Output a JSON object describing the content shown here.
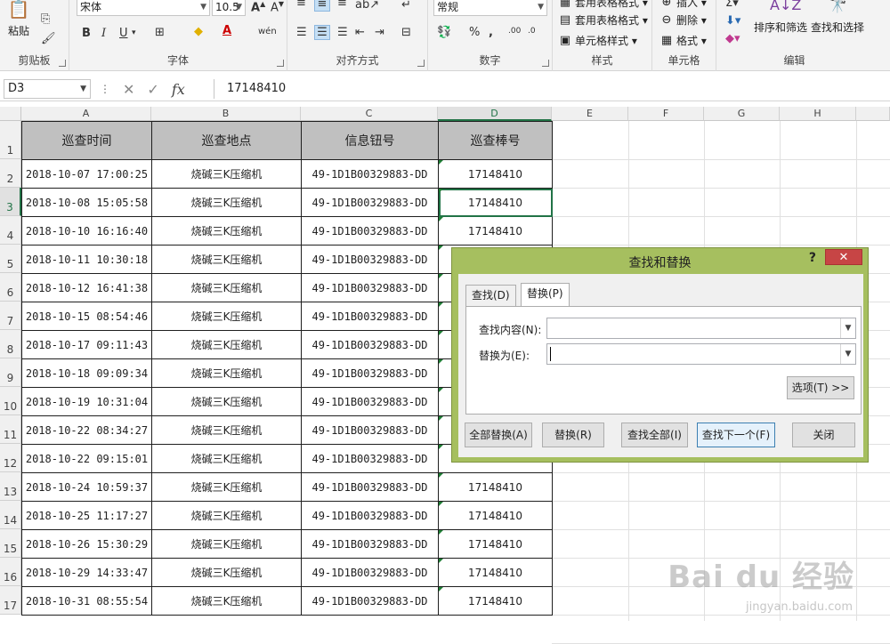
{
  "ribbon": {
    "clipboard": {
      "paste_label": "粘贴",
      "group_title": "剪贴板"
    },
    "font": {
      "font_name": "宋体",
      "font_size": "10.5",
      "bold": "B",
      "italic": "I",
      "underline": "U",
      "wen": "wén",
      "group_title": "字体"
    },
    "alignment": {
      "group_title": "对齐方式"
    },
    "number": {
      "format": "常规",
      "percent": "%",
      "comma": ",",
      "group_title": "数字"
    },
    "styles": {
      "conditional_label": "套用表格格式 ▾",
      "table_label": "套用表格格式 ▾",
      "cell_label": "单元格样式 ▾",
      "group_title": "样式"
    },
    "cells": {
      "insert_label": "插入 ▾",
      "delete_label": "删除 ▾",
      "format_label": "格式 ▾",
      "group_title": "单元格"
    },
    "editing": {
      "sort_label": "排序和筛选",
      "find_label": "查找和选择",
      "group_title": "编辑"
    }
  },
  "formula_bar": {
    "name_box": "D3",
    "formula": "17148410",
    "fx": "fx"
  },
  "sheet": {
    "column_letters": [
      "A",
      "B",
      "C",
      "D",
      "E",
      "F",
      "G",
      "H"
    ],
    "row_numbers": [
      "1",
      "2",
      "3",
      "4",
      "5",
      "6",
      "7",
      "8",
      "9",
      "10",
      "11",
      "12",
      "13",
      "14",
      "15",
      "16",
      "17"
    ],
    "headers": [
      "巡查时间",
      "巡查地点",
      "信息钮号",
      "巡查棒号"
    ],
    "rows": [
      [
        "2018-10-07 17:00:25",
        "烧碱三K压缩机",
        "49-1D1B00329883-DD",
        "17148410"
      ],
      [
        "2018-10-08 15:05:58",
        "烧碱三K压缩机",
        "49-1D1B00329883-DD",
        "17148410"
      ],
      [
        "2018-10-10 16:16:40",
        "烧碱三K压缩机",
        "49-1D1B00329883-DD",
        "17148410"
      ],
      [
        "2018-10-11 10:30:18",
        "烧碱三K压缩机",
        "49-1D1B00329883-DD",
        ""
      ],
      [
        "2018-10-12 16:41:38",
        "烧碱三K压缩机",
        "49-1D1B00329883-DD",
        ""
      ],
      [
        "2018-10-15 08:54:46",
        "烧碱三K压缩机",
        "49-1D1B00329883-DD",
        ""
      ],
      [
        "2018-10-17 09:11:43",
        "烧碱三K压缩机",
        "49-1D1B00329883-DD",
        ""
      ],
      [
        "2018-10-18 09:09:34",
        "烧碱三K压缩机",
        "49-1D1B00329883-DD",
        ""
      ],
      [
        "2018-10-19 10:31:04",
        "烧碱三K压缩机",
        "49-1D1B00329883-DD",
        ""
      ],
      [
        "2018-10-22 08:34:27",
        "烧碱三K压缩机",
        "49-1D1B00329883-DD",
        ""
      ],
      [
        "2018-10-22 09:15:01",
        "烧碱三K压缩机",
        "49-1D1B00329883-DD",
        ""
      ],
      [
        "2018-10-24 10:59:37",
        "烧碱三K压缩机",
        "49-1D1B00329883-DD",
        "17148410"
      ],
      [
        "2018-10-25 11:17:27",
        "烧碱三K压缩机",
        "49-1D1B00329883-DD",
        "17148410"
      ],
      [
        "2018-10-26 15:30:29",
        "烧碱三K压缩机",
        "49-1D1B00329883-DD",
        "17148410"
      ],
      [
        "2018-10-29 14:33:47",
        "烧碱三K压缩机",
        "49-1D1B00329883-DD",
        "17148410"
      ],
      [
        "2018-10-31 08:55:54",
        "烧碱三K压缩机",
        "49-1D1B00329883-DD",
        "17148410"
      ]
    ]
  },
  "dialog": {
    "title": "查找和替换",
    "help": "?",
    "close": "✕",
    "tab_find": "查找(D)",
    "tab_replace": "替换(P)",
    "find_label": "查找内容(N):",
    "find_value": "",
    "replace_label": "替换为(E):",
    "replace_value": "",
    "options_button": "选项(T) >>",
    "replace_all_button": "全部替换(A)",
    "replace_button": "替换(R)",
    "find_all_button": "查找全部(I)",
    "find_next_button": "查找下一个(F)",
    "close_button": "关闭"
  },
  "watermark": {
    "main": "Bai du 经验",
    "sub": "jingyan.baidu.com"
  },
  "colors": {
    "excel_green": "#217346",
    "dialog_frame": "#a6bf5f",
    "close_red": "#c74545",
    "header_fill": "#c0c0c0"
  }
}
